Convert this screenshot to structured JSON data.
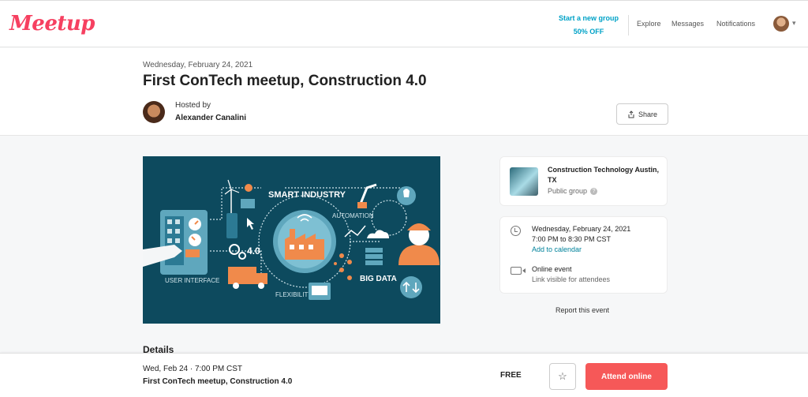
{
  "nav": {
    "logo": "Meetup",
    "promo_line1": "Start a new group",
    "promo_line2": "50% OFF",
    "links": [
      "Explore",
      "Messages",
      "Notifications"
    ]
  },
  "event": {
    "date": "Wednesday, February 24, 2021",
    "title": "First ConTech meetup, Construction 4.0",
    "hosted_by_label": "Hosted by",
    "host_name": "Alexander Canalini",
    "share_label": "Share"
  },
  "hero": {
    "labels": {
      "smart_industry": "SMART INDUSTRY",
      "automation": "AUTOMATION",
      "user_interface": "USER INTERFACE",
      "version": "4.0",
      "flexibility": "FLEXIBILITY",
      "big_data": "BIG DATA"
    }
  },
  "group": {
    "name": "Construction Technology Austin, TX",
    "type": "Public group"
  },
  "info": {
    "date": "Wednesday, February 24, 2021",
    "time": "7:00 PM to 8:30 PM CST",
    "add_to_calendar": "Add to calendar",
    "online_event": "Online event",
    "link_visible": "Link visible for attendees"
  },
  "report_label": "Report this event",
  "details_heading": "Details",
  "bottom_bar": {
    "date": "Wed, Feb 24 · 7:00 PM CST",
    "title": "First ConTech meetup, Construction 4.0",
    "price": "FREE",
    "attend_label": "Attend online"
  },
  "colors": {
    "brand": "#f64060",
    "teal_link": "#00a2c7",
    "attend_button": "#f65858",
    "hero_bg": "#0d4a5e",
    "accent_orange": "#f08a4b"
  }
}
